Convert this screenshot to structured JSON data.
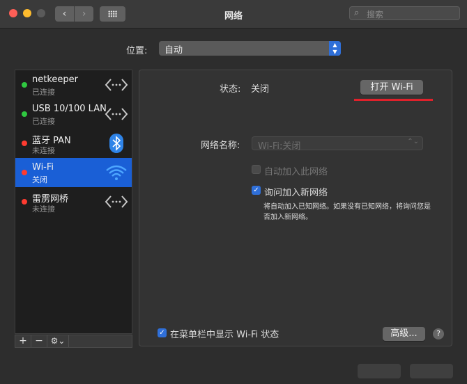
{
  "window": {
    "title": "网络"
  },
  "toolbar": {
    "back_icon": "chevron-left-icon",
    "forward_icon": "chevron-right-icon",
    "show_all_icon": "grid-icon",
    "search_placeholder": "搜索"
  },
  "location": {
    "label": "位置:",
    "value": "自动"
  },
  "services": [
    {
      "name": "netkeeper",
      "status": "已连接",
      "status_color": "green",
      "icon": "ethernet-arrows-icon"
    },
    {
      "name": "USB 10/100 LAN",
      "status": "已连接",
      "status_color": "green",
      "icon": "ethernet-arrows-icon"
    },
    {
      "name": "蓝牙 PAN",
      "status": "未连接",
      "status_color": "red",
      "icon": "bluetooth-icon"
    },
    {
      "name": "Wi-Fi",
      "status": "关闭",
      "status_color": "red",
      "icon": "wifi-icon",
      "selected": true
    },
    {
      "name": "雷雳网桥",
      "status": "未连接",
      "status_color": "red",
      "icon": "ethernet-arrows-icon"
    }
  ],
  "sidebar_toolbar": {
    "add": "+",
    "remove": "−",
    "gear": "⚙︎⌄"
  },
  "detail": {
    "status_label": "状态:",
    "status_value": "关闭",
    "turn_on_button": "打开 Wi-Fi",
    "network_name_label": "网络名称:",
    "network_name_value": "Wi-Fi:关闭",
    "auto_join_label": "自动加入此网络",
    "auto_join_checked": false,
    "ask_join_label": "询问加入新网络",
    "ask_join_checked": true,
    "ask_join_desc": "将自动加入已知网络。如果没有已知网络，将询问您是否加入新网络。",
    "show_in_menubar_label": "在菜单栏中显示 Wi-Fi 状态",
    "show_in_menubar_checked": true,
    "advanced_button": "高级...",
    "help_button": "?"
  },
  "colors": {
    "accent": "#2f6fd8",
    "selection": "#1a5fd6",
    "annotation": "#e0212b"
  }
}
